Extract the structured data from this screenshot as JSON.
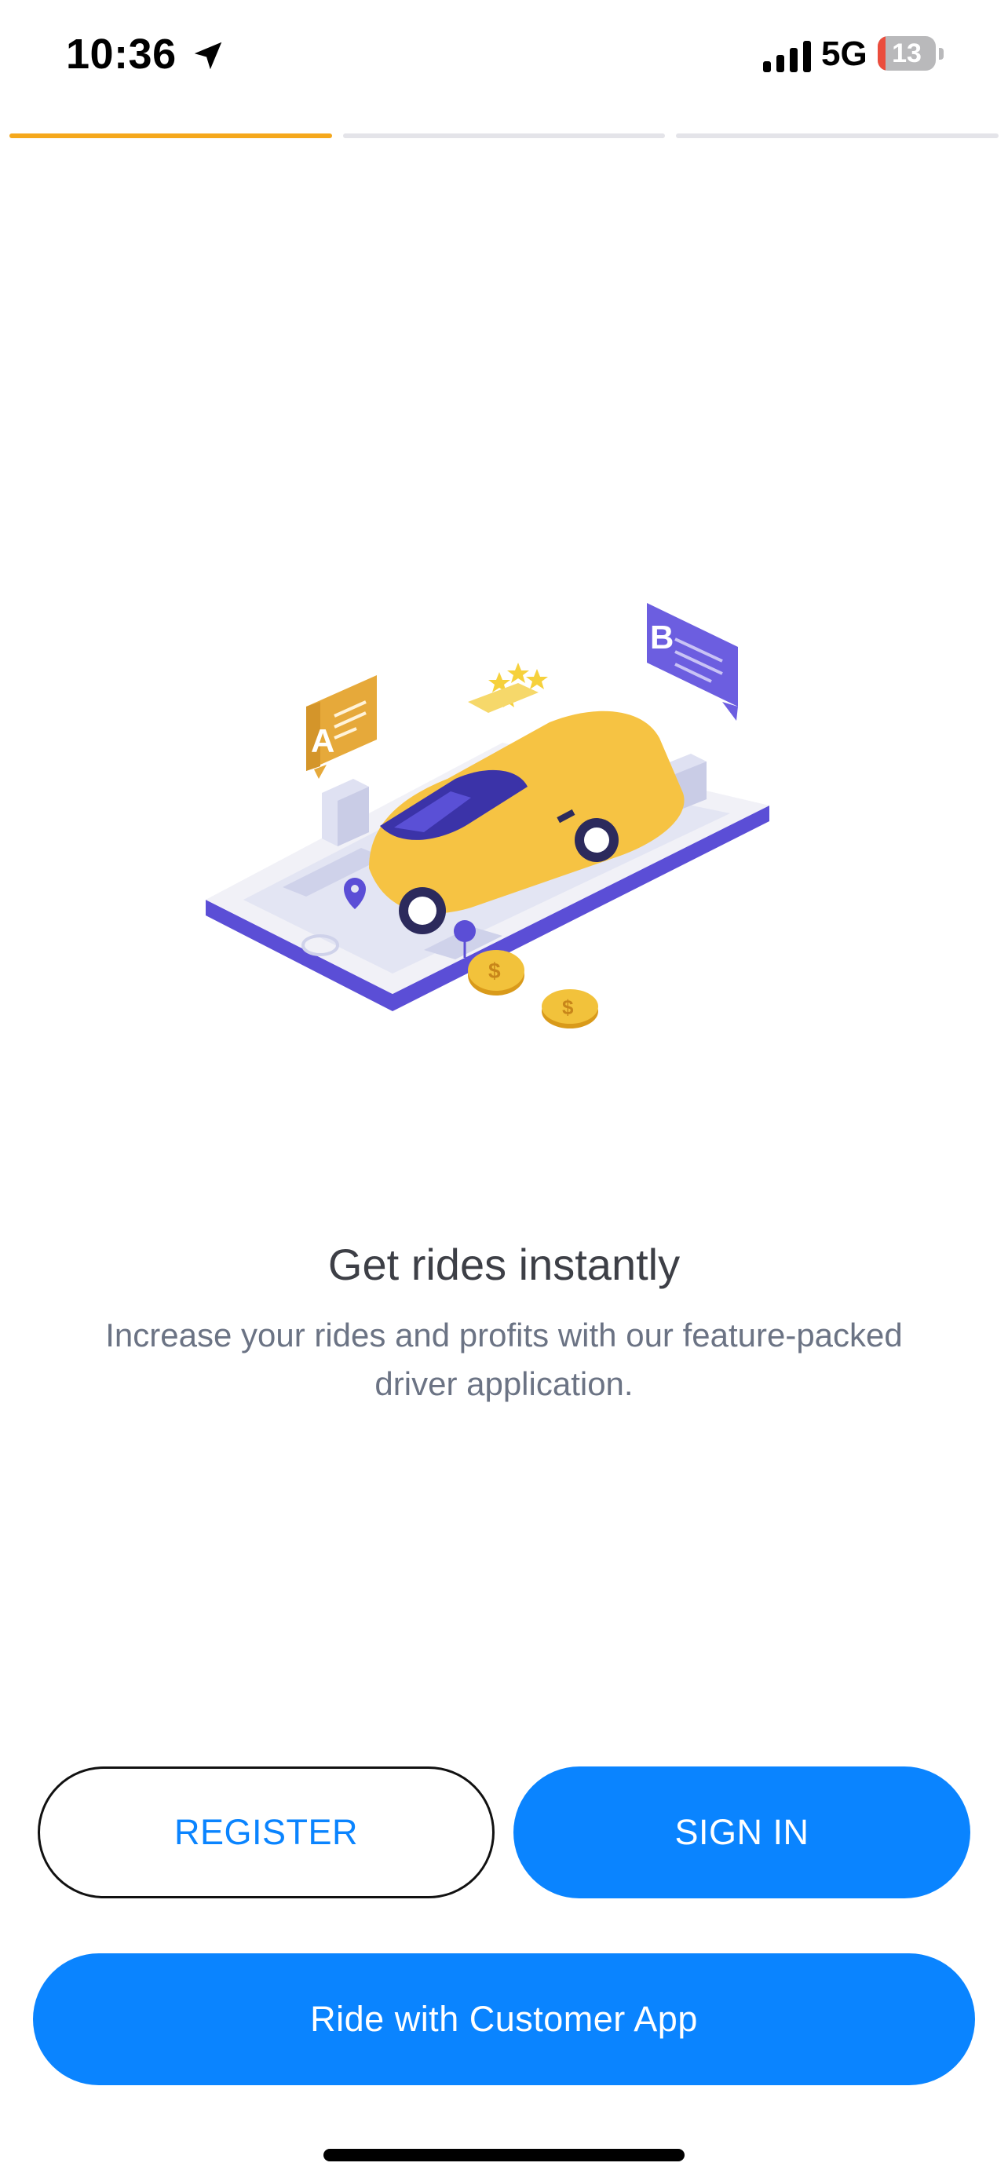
{
  "status_bar": {
    "time": "10:36",
    "network": "5G",
    "battery": "13",
    "battery_level": 0.13,
    "location_icon": "location-arrow-icon",
    "signal_icon": "signal-bars-icon",
    "battery_icon": "battery-icon"
  },
  "onboarding": {
    "steps_total": 3,
    "current_step": 1
  },
  "illustration": {
    "marker_a": "A",
    "marker_b": "B",
    "icon": "taxi-illustration"
  },
  "content": {
    "title": "Get rides instantly",
    "subtitle": "Increase your rides and profits with our feature-packed driver application."
  },
  "actions": {
    "register_label": "REGISTER",
    "signin_label": "SIGN IN",
    "customer_label": "Ride with Customer App"
  },
  "colors": {
    "accent": "#f5a81c",
    "primary": "#0a84ff",
    "progress_inactive": "#e4e4e9",
    "title_text": "#3d3f46",
    "subtitle_text": "#6b7384"
  }
}
